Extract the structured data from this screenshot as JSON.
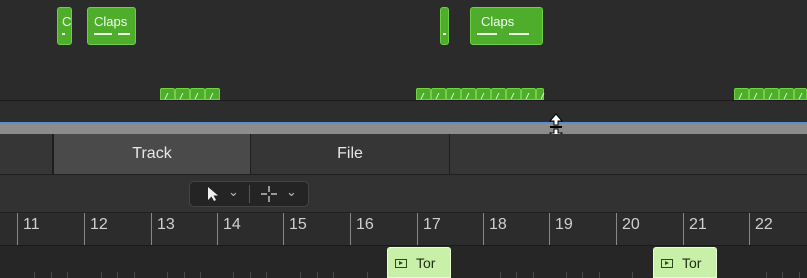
{
  "regions_top": [
    {
      "label": "C",
      "kind": "claps-clip"
    },
    {
      "label": "Claps",
      "kind": "claps-clip"
    },
    {
      "label": "",
      "kind": "claps-clip"
    },
    {
      "label": "Claps",
      "kind": "claps-clip"
    }
  ],
  "tabs": [
    {
      "label": "",
      "active": false
    },
    {
      "label": "Track",
      "active": true
    },
    {
      "label": "File",
      "active": false
    }
  ],
  "toolbar": {
    "pointer_tool_icon": "arrow-pointer-icon",
    "pointer_tool_chevron": "⌄",
    "marquee_tool_icon": "crosshair-icon",
    "marquee_tool_chevron": "⌄"
  },
  "ruler": {
    "bars": [
      "11",
      "12",
      "13",
      "14",
      "15",
      "16",
      "17",
      "18",
      "19",
      "20",
      "21",
      "22"
    ]
  },
  "lane_regions": [
    {
      "label": "Tor",
      "icon": "play-region-icon"
    },
    {
      "label": "Tor",
      "icon": "play-region-icon"
    }
  ],
  "colors": {
    "region_green": "#4eae2c",
    "lane_region_green": "#c8f0a8",
    "divider_blue": "#5a8fd8"
  }
}
